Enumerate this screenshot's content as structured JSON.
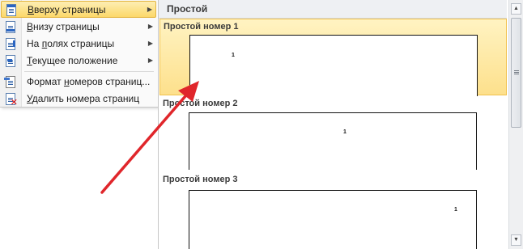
{
  "menu": {
    "items": [
      {
        "label": "Вверху страницы",
        "accel": "В",
        "rest": "верху страницы",
        "icon": "page-header-icon",
        "submenu": true,
        "active": true
      },
      {
        "label": "Внизу страницы",
        "accel": "В",
        "rest": "низу страницы",
        "icon": "page-footer-icon",
        "submenu": true
      },
      {
        "label": "На полях страницы",
        "pre": "На ",
        "accel": "п",
        "rest": "олях страницы",
        "icon": "page-margin-icon",
        "submenu": true
      },
      {
        "label": "Текущее положение",
        "accel": "Т",
        "rest": "екущее положение",
        "icon": "current-position-icon",
        "submenu": true
      },
      {
        "label": "Формат номеров страниц...",
        "pre": "Формат ",
        "accel": "н",
        "rest": "омеров страниц...",
        "icon": "format-page-numbers-icon",
        "submenu": false
      },
      {
        "label": "Удалить номера страниц",
        "accel": "У",
        "rest": "далить номера страниц",
        "icon": "remove-page-numbers-icon",
        "submenu": false
      }
    ]
  },
  "gallery": {
    "section_title": "Простой",
    "tiles": [
      {
        "title": "Простой номер 1",
        "number": "1",
        "align": "left",
        "selected": true
      },
      {
        "title": "Простой номер 2",
        "number": "1",
        "align": "center",
        "selected": false
      },
      {
        "title": "Простой номер 3",
        "number": "1",
        "align": "right",
        "selected": false
      }
    ]
  },
  "annotation": {
    "color": "#e0262b"
  }
}
